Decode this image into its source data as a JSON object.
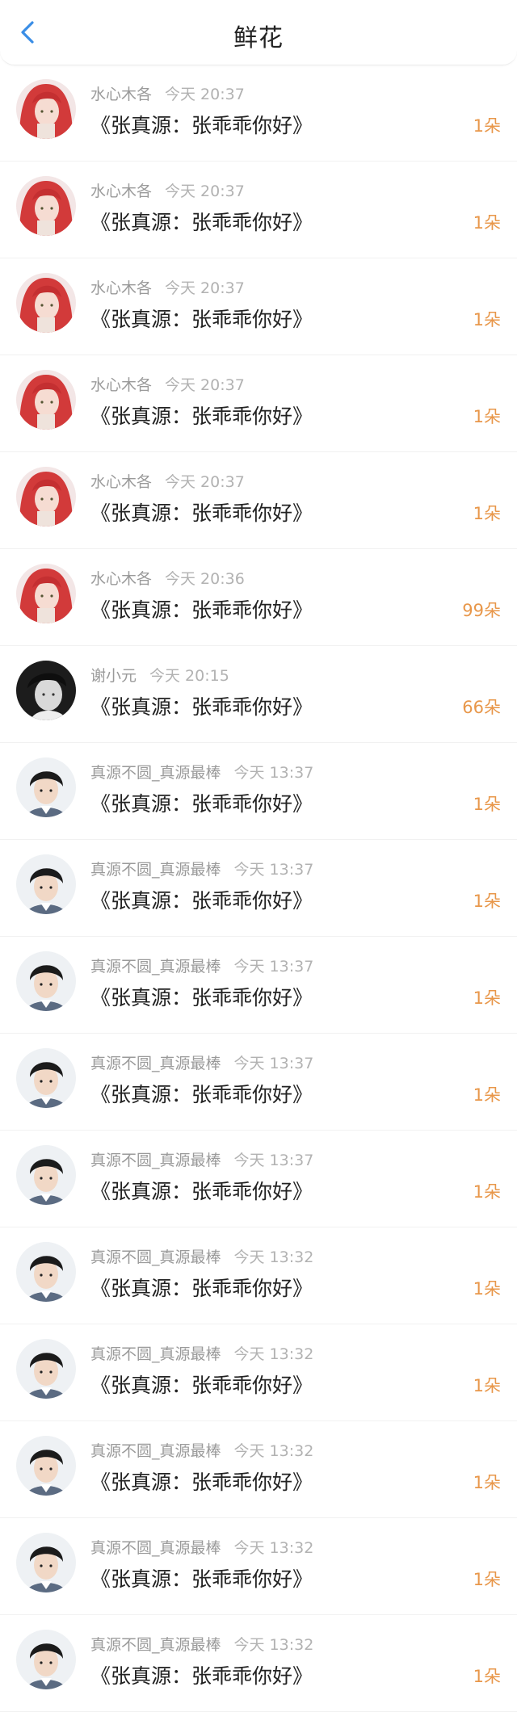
{
  "header": {
    "title": "鲜花",
    "back_icon": "chevron-left-icon",
    "accent_color": "#3a8ee6"
  },
  "count_color": "#e8974a",
  "rows": [
    {
      "name": "水心木各",
      "time": "今天 20:37",
      "message": "《张真源：张乖乖你好》",
      "count": "1朵",
      "avatar": "red-hair"
    },
    {
      "name": "水心木各",
      "time": "今天 20:37",
      "message": "《张真源：张乖乖你好》",
      "count": "1朵",
      "avatar": "red-hair"
    },
    {
      "name": "水心木各",
      "time": "今天 20:37",
      "message": "《张真源：张乖乖你好》",
      "count": "1朵",
      "avatar": "red-hair"
    },
    {
      "name": "水心木各",
      "time": "今天 20:37",
      "message": "《张真源：张乖乖你好》",
      "count": "1朵",
      "avatar": "red-hair"
    },
    {
      "name": "水心木各",
      "time": "今天 20:37",
      "message": "《张真源：张乖乖你好》",
      "count": "1朵",
      "avatar": "red-hair"
    },
    {
      "name": "水心木各",
      "time": "今天 20:36",
      "message": "《张真源：张乖乖你好》",
      "count": "99朵",
      "avatar": "red-hair"
    },
    {
      "name": "谢小元",
      "time": "今天 20:15",
      "message": "《张真源：张乖乖你好》",
      "count": "66朵",
      "avatar": "bw"
    },
    {
      "name": "真源不圆_真源最棒",
      "time": "今天 13:37",
      "message": "《张真源：张乖乖你好》",
      "count": "1朵",
      "avatar": "boy"
    },
    {
      "name": "真源不圆_真源最棒",
      "time": "今天 13:37",
      "message": "《张真源：张乖乖你好》",
      "count": "1朵",
      "avatar": "boy"
    },
    {
      "name": "真源不圆_真源最棒",
      "time": "今天 13:37",
      "message": "《张真源：张乖乖你好》",
      "count": "1朵",
      "avatar": "boy"
    },
    {
      "name": "真源不圆_真源最棒",
      "time": "今天 13:37",
      "message": "《张真源：张乖乖你好》",
      "count": "1朵",
      "avatar": "boy"
    },
    {
      "name": "真源不圆_真源最棒",
      "time": "今天 13:37",
      "message": "《张真源：张乖乖你好》",
      "count": "1朵",
      "avatar": "boy"
    },
    {
      "name": "真源不圆_真源最棒",
      "time": "今天 13:32",
      "message": "《张真源：张乖乖你好》",
      "count": "1朵",
      "avatar": "boy"
    },
    {
      "name": "真源不圆_真源最棒",
      "time": "今天 13:32",
      "message": "《张真源：张乖乖你好》",
      "count": "1朵",
      "avatar": "boy"
    },
    {
      "name": "真源不圆_真源最棒",
      "time": "今天 13:32",
      "message": "《张真源：张乖乖你好》",
      "count": "1朵",
      "avatar": "boy"
    },
    {
      "name": "真源不圆_真源最棒",
      "time": "今天 13:32",
      "message": "《张真源：张乖乖你好》",
      "count": "1朵",
      "avatar": "boy"
    },
    {
      "name": "真源不圆_真源最棒",
      "time": "今天 13:32",
      "message": "《张真源：张乖乖你好》",
      "count": "1朵",
      "avatar": "boy"
    }
  ]
}
